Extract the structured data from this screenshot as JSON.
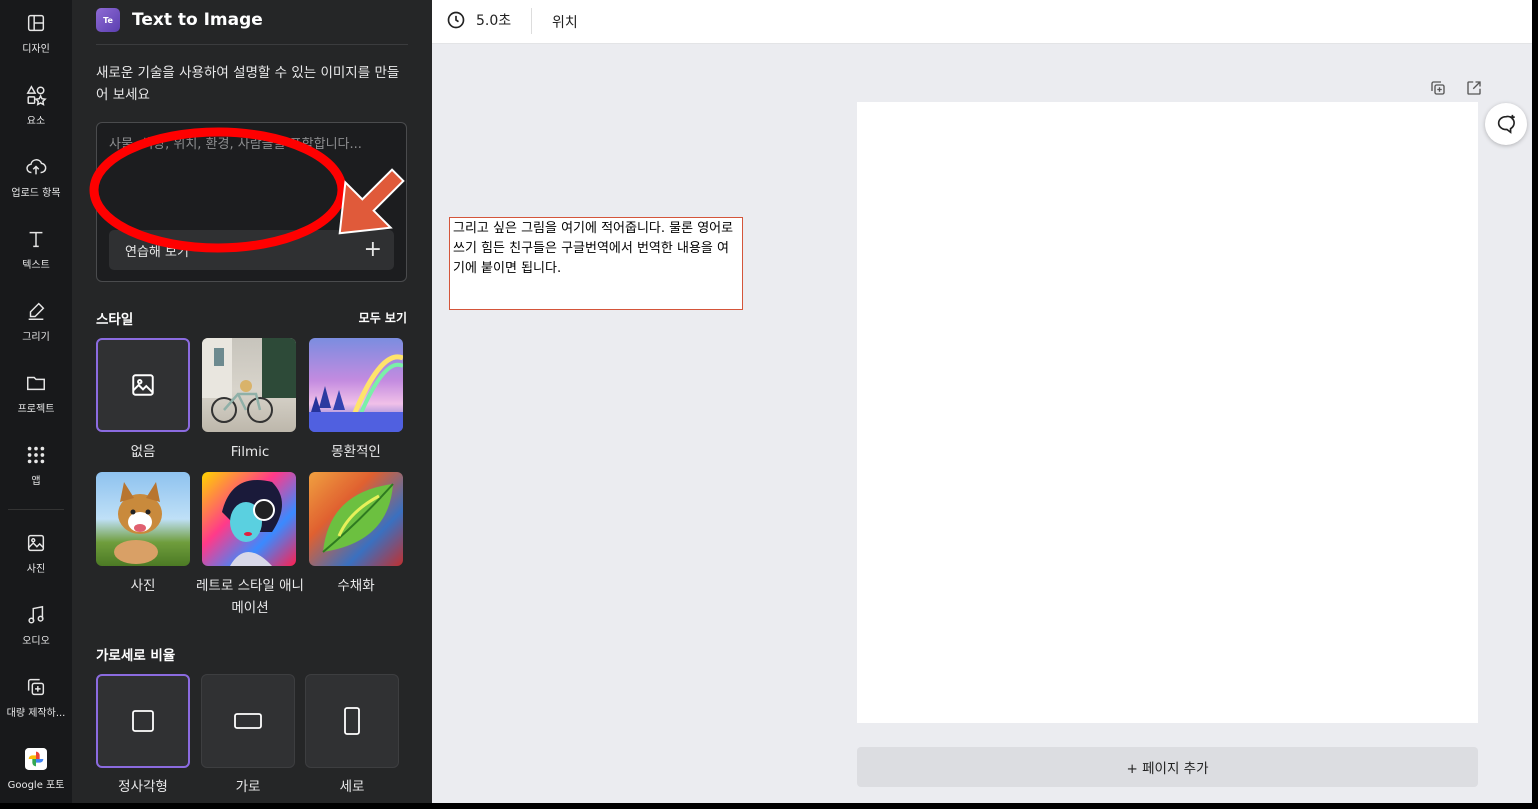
{
  "rail": {
    "items": [
      {
        "label": "디자인",
        "icon": "layout-icon"
      },
      {
        "label": "요소",
        "icon": "shapes-icon"
      },
      {
        "label": "업로드 항목",
        "icon": "cloud-upload-icon"
      },
      {
        "label": "텍스트",
        "icon": "text-icon"
      },
      {
        "label": "그리기",
        "icon": "pen-icon"
      },
      {
        "label": "프로젝트",
        "icon": "folder-icon"
      },
      {
        "label": "앱",
        "icon": "apps-grid-icon"
      },
      {
        "label": "사진",
        "icon": "image-icon"
      },
      {
        "label": "오디오",
        "icon": "music-note-icon"
      },
      {
        "label": "대량 제작하...",
        "icon": "bulk-create-icon"
      },
      {
        "label": "Google 포토",
        "icon": "google-photos-icon"
      }
    ]
  },
  "panel": {
    "logo_text": "Te\nXt",
    "title": "Text to Image",
    "description": "새로운 기술을 사용하여 설명할 수 있는 이미지를 만들어 보세요",
    "prompt_placeholder": "사물, 색상, 위치, 환경, 사람들을 포함합니다...",
    "try_label": "연습해 보기",
    "try_plus": "+",
    "style_section": "스타일",
    "see_all": "모두 보기",
    "styles": [
      {
        "label": "없음"
      },
      {
        "label": "Filmic"
      },
      {
        "label": "몽환적인"
      },
      {
        "label": "사진"
      },
      {
        "label": "레트로 스타일 애니메이션"
      },
      {
        "label": "수채화"
      }
    ],
    "ratio_section": "가로세로 비율",
    "ratios": [
      {
        "label": "정사각형"
      },
      {
        "label": "가로"
      },
      {
        "label": "세로"
      }
    ],
    "collapse": "‹"
  },
  "topbar": {
    "duration": "5.0초",
    "position": "위치"
  },
  "canvas": {
    "add_page": "+ 페이지 추가"
  },
  "note": {
    "text": "그리고 싶은 그림을 여기에 적어줍니다. 물론 영어로 쓰기 힘든 친구들은 구글번역에서 번역한 내용을 여기에 붙이면 됩니다."
  },
  "colors": {
    "accent": "#8b6be0",
    "annotation_red": "#ff0000",
    "arrow": "#e05a3a"
  }
}
